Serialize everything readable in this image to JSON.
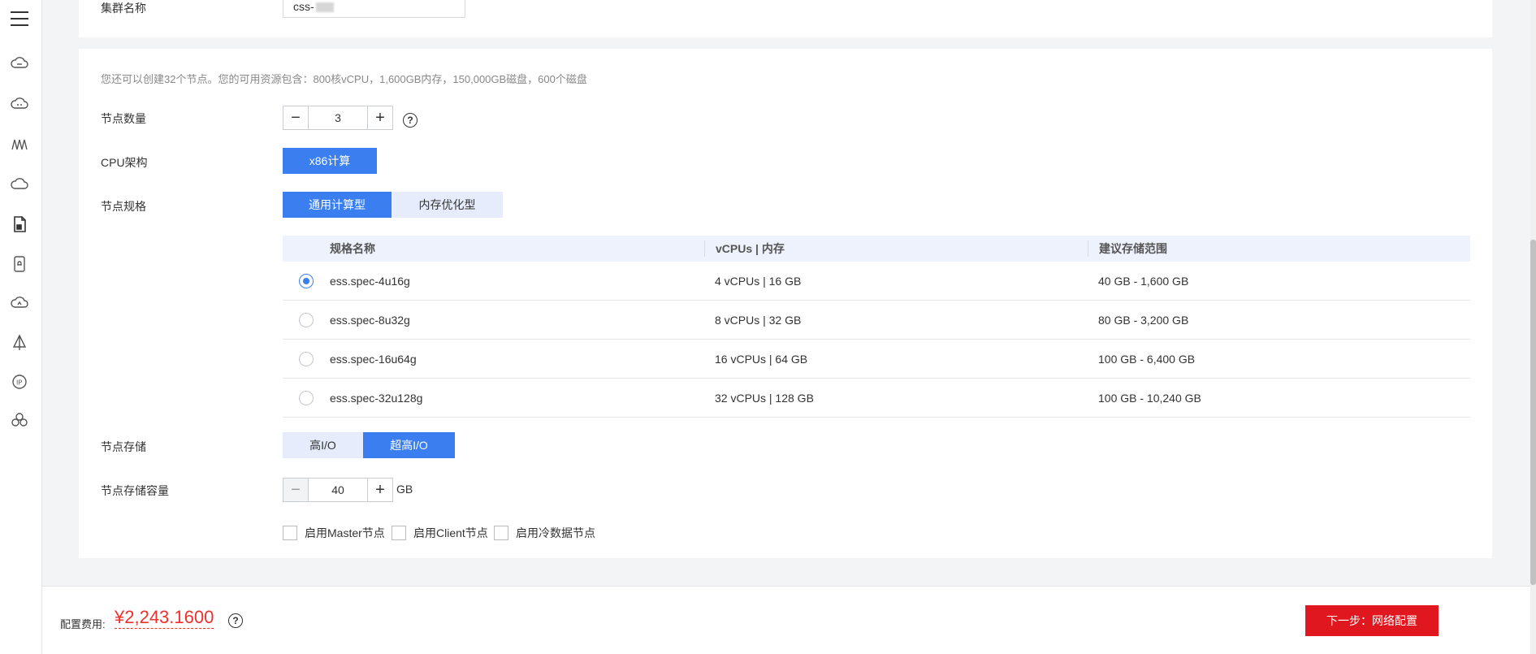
{
  "cluster_name": {
    "label": "集群名称",
    "value": "css-"
  },
  "node_config": {
    "hint": "您还可以创建32个节点。您的可用资源包含：800核vCPU，1,600GB内存，150,000GB磁盘，600个磁盘",
    "node_count": {
      "label": "节点数量",
      "value": "3",
      "help": "?"
    },
    "cpu_arch": {
      "label": "CPU架构",
      "selected": "x86计算"
    },
    "node_spec": {
      "label": "节点规格",
      "tabs": [
        "通用计算型",
        "内存优化型"
      ],
      "active_tab": "通用计算型",
      "columns": [
        "规格名称",
        "vCPUs | 内存",
        "建议存储范围"
      ],
      "rows": [
        {
          "name": "ess.spec-4u16g",
          "cpu_mem": "4 vCPUs | 16 GB",
          "storage": "40 GB - 1,600 GB",
          "selected": true
        },
        {
          "name": "ess.spec-8u32g",
          "cpu_mem": "8 vCPUs | 32 GB",
          "storage": "80 GB - 3,200 GB",
          "selected": false
        },
        {
          "name": "ess.spec-16u64g",
          "cpu_mem": "16 vCPUs | 64 GB",
          "storage": "100 GB - 6,400 GB",
          "selected": false
        },
        {
          "name": "ess.spec-32u128g",
          "cpu_mem": "32 vCPUs | 128 GB",
          "storage": "100 GB - 10,240 GB",
          "selected": false
        }
      ]
    },
    "node_storage": {
      "label": "节点存储",
      "options": [
        "高I/O",
        "超高I/O"
      ],
      "selected": "超高I/O"
    },
    "storage_capacity": {
      "label": "节点存储容量",
      "value": "40",
      "unit": "GB"
    },
    "checkboxes": [
      "启用Master节点",
      "启用Client节点",
      "启用冷数据节点"
    ]
  },
  "footer": {
    "fee_label": "配置费用:",
    "fee_value": "¥2,243.1600",
    "next_button": "下一步：网络配置"
  },
  "colors": {
    "primary": "#3a7ef0",
    "danger": "#e0171e",
    "price": "#f0302c"
  },
  "rail_icons": [
    "menu-icon",
    "cloud-server-icon",
    "cloud-db-icon",
    "network-icon",
    "cloud-icon",
    "document-icon",
    "phone-icon",
    "cloud-sync-icon",
    "sail-icon",
    "ip-icon",
    "cluster-icon"
  ]
}
